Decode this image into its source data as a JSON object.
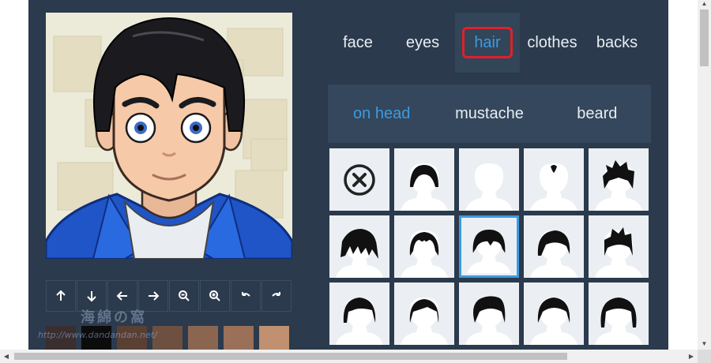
{
  "categories": [
    {
      "label": "face",
      "active": false
    },
    {
      "label": "eyes",
      "active": false
    },
    {
      "label": "hair",
      "active": true
    },
    {
      "label": "clothes",
      "active": false
    },
    {
      "label": "backs",
      "active": false
    }
  ],
  "subcategories": [
    {
      "label": "on head",
      "active": true
    },
    {
      "label": "mustache",
      "active": false
    },
    {
      "label": "beard",
      "active": false
    }
  ],
  "toolbar": [
    "arrow-up-icon",
    "arrow-down-icon",
    "arrow-left-icon",
    "arrow-right-icon",
    "zoom-out-icon",
    "zoom-in-icon",
    "undo-icon",
    "redo-icon"
  ],
  "skin_swatches": [
    "#3a2e2e",
    "#0c0c0c",
    "#5a3f33",
    "#6e5040",
    "#8a6650",
    "#9a7058",
    "#c09070"
  ],
  "hair_options": [
    {
      "name": "no-hair",
      "selected": false
    },
    {
      "name": "short-crop",
      "selected": false
    },
    {
      "name": "bald",
      "selected": false
    },
    {
      "name": "balding-tuft",
      "selected": false
    },
    {
      "name": "spiky-top",
      "selected": false
    },
    {
      "name": "messy-fringe",
      "selected": false
    },
    {
      "name": "receding",
      "selected": false
    },
    {
      "name": "mushroom-cut",
      "selected": true
    },
    {
      "name": "side-swept",
      "selected": false
    },
    {
      "name": "spiky-quiff",
      "selected": false
    },
    {
      "name": "classic-side",
      "selected": false
    },
    {
      "name": "short-side-part",
      "selected": false
    },
    {
      "name": "pompadour",
      "selected": false
    },
    {
      "name": "slick-back",
      "selected": false
    },
    {
      "name": "long-sides",
      "selected": false
    }
  ],
  "colors": {
    "accent": "#3d9be0",
    "panel": "#2b3a4c",
    "highlight": "#e0202a"
  },
  "watermark": {
    "text": "海綿の窩",
    "url": "http://www.dandandan.net/"
  }
}
